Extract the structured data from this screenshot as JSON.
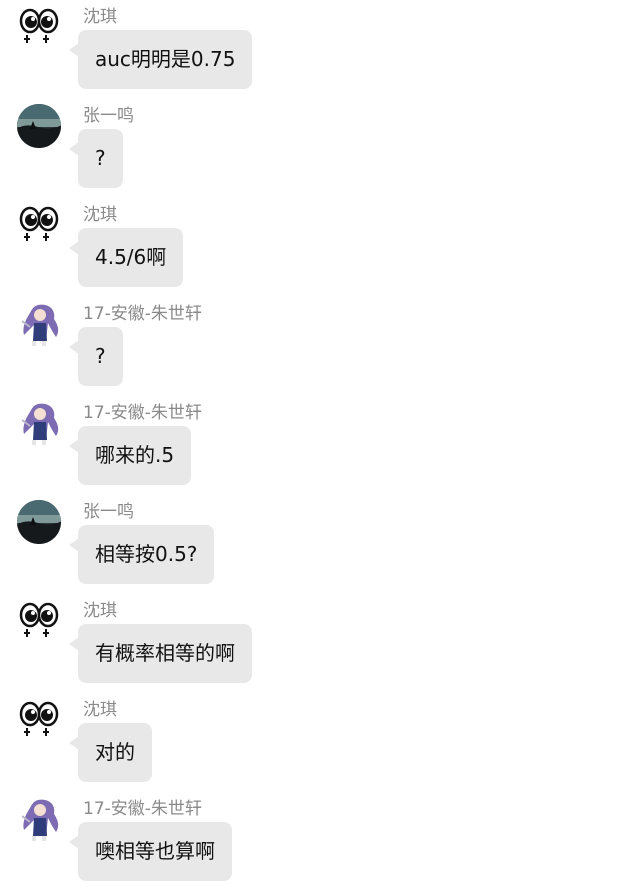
{
  "messages": [
    {
      "sender": "沈琪",
      "avatar_icon": "cartoon-eyes-icon",
      "text": "auc明明是0.75"
    },
    {
      "sender": "张一鸣",
      "avatar_icon": "dusk-landscape-icon",
      "text": "?"
    },
    {
      "sender": "沈琪",
      "avatar_icon": "cartoon-eyes-icon",
      "text": "4.5/6啊"
    },
    {
      "sender": "17-安徽-朱世轩",
      "avatar_icon": "anime-girl-icon",
      "text": "?"
    },
    {
      "sender": "17-安徽-朱世轩",
      "avatar_icon": "anime-girl-icon",
      "text": "哪来的.5"
    },
    {
      "sender": "张一鸣",
      "avatar_icon": "dusk-landscape-icon",
      "text": "相等按0.5?"
    },
    {
      "sender": "沈琪",
      "avatar_icon": "cartoon-eyes-icon",
      "text": "有概率相等的啊"
    },
    {
      "sender": "沈琪",
      "avatar_icon": "cartoon-eyes-icon",
      "text": "对的"
    },
    {
      "sender": "17-安徽-朱世轩",
      "avatar_icon": "anime-girl-icon",
      "text": "噢相等也算啊"
    }
  ],
  "colors": {
    "bubble": "#e8e8e8",
    "sender_text": "#8a8a8a",
    "message_text": "#111111"
  }
}
